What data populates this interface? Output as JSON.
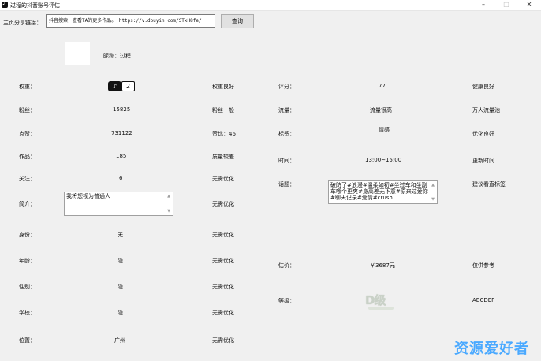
{
  "window": {
    "title": "过程的抖音账号评估",
    "minimize": "–",
    "maximize": "□",
    "close": "✕"
  },
  "query": {
    "label": "主页分享链接：",
    "url_value": "抖音搜索，查看TA的更多作品。 https://v.douyin.com/STxH8fe/",
    "button": "查询"
  },
  "profile": {
    "nickname": "昵称：过程"
  },
  "left": [
    {
      "label": "权重：",
      "value": "",
      "status": "权重良好"
    },
    {
      "label": "粉丝：",
      "value": "15825",
      "status": "粉丝一般"
    },
    {
      "label": "点赞：",
      "value": "731122",
      "status": "赞比：46"
    },
    {
      "label": "作品：",
      "value": "185",
      "status": "质量较差"
    },
    {
      "label": "关注：",
      "value": "6",
      "status": "无需优化"
    },
    {
      "label": "简介：",
      "value": "我将您视为普通人",
      "status": "无需优化"
    },
    {
      "label": "身份：",
      "value": "无",
      "status": "无需优化"
    },
    {
      "label": "年龄：",
      "value": "隐",
      "status": "无需优化"
    },
    {
      "label": "性别：",
      "value": "隐",
      "status": "无需优化"
    },
    {
      "label": "学校：",
      "value": "隐",
      "status": "无需优化"
    },
    {
      "label": "位置：",
      "value": "广州",
      "status": "无需优化"
    }
  ],
  "weight_badge": {
    "icon": "tiktok-icon",
    "glyph": "♪",
    "level": "2"
  },
  "right": [
    {
      "label": "评分：",
      "value": "77",
      "status": "健康良好"
    },
    {
      "label": "流量：",
      "value": "流量很高",
      "status": "万人流量池"
    },
    {
      "label": "标签：",
      "value": "情感",
      "status": "优化良好"
    },
    {
      "label": "时间：",
      "value": "13:00~15:00",
      "status": "更新时间"
    },
    {
      "label": "话题：",
      "value": "破防了#浪漫#温柔如初#坐过车和坐副车哪个更爽#身高差无下意#原来过爱你#聊天记录#爱情#crush",
      "status": "建议看直标签"
    },
    {
      "label": "估价：",
      "value": "￥3687元",
      "status": "仅供参考"
    },
    {
      "label": "等级：",
      "value": "D级",
      "status": "ABCDEF"
    }
  ],
  "watermark": "资源爱好者",
  "colors": {
    "watermark": "#4aa9ff",
    "grade": "#c9d1c7"
  }
}
